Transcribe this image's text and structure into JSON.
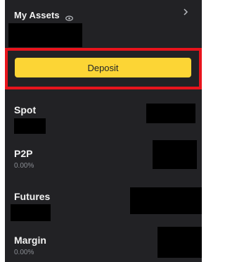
{
  "header": {
    "title": "My Assets",
    "eye_icon": "eye-icon",
    "chevron_icon": "chevron-right-icon"
  },
  "deposit": {
    "label": "Deposit",
    "color": "#fcd535",
    "highlight_color": "#e8141c"
  },
  "accounts": [
    {
      "name": "Spot"
    },
    {
      "name": "P2P",
      "sub": "0.00%"
    },
    {
      "name": "Futures"
    },
    {
      "name": "Margin",
      "sub": "0.00%"
    }
  ]
}
